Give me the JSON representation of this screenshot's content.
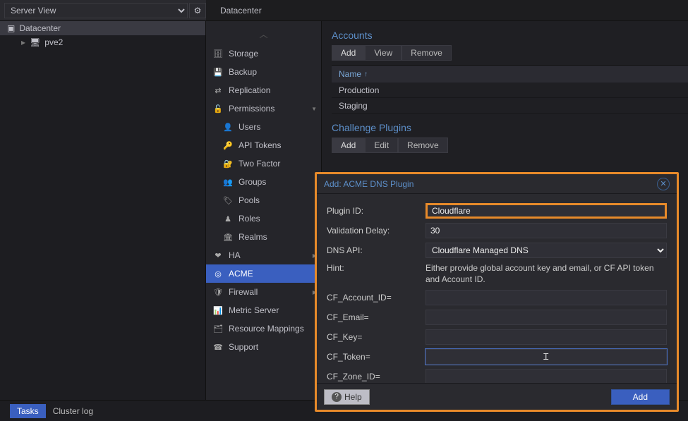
{
  "header": {
    "view_selector": "Server View",
    "breadcrumb": "Datacenter"
  },
  "tree": {
    "datacenter": "Datacenter",
    "node": "pve2"
  },
  "submenu": {
    "items": [
      {
        "icon": "storage",
        "label": "Storage"
      },
      {
        "icon": "backup",
        "label": "Backup"
      },
      {
        "icon": "replication",
        "label": "Replication"
      },
      {
        "icon": "permissions",
        "label": "Permissions",
        "chevron": "down"
      },
      {
        "icon": "users",
        "label": "Users",
        "indent": true
      },
      {
        "icon": "tokens",
        "label": "API Tokens",
        "indent": true
      },
      {
        "icon": "twofactor",
        "label": "Two Factor",
        "indent": true
      },
      {
        "icon": "groups",
        "label": "Groups",
        "indent": true
      },
      {
        "icon": "pools",
        "label": "Pools",
        "indent": true
      },
      {
        "icon": "roles",
        "label": "Roles",
        "indent": true
      },
      {
        "icon": "realms",
        "label": "Realms",
        "indent": true
      },
      {
        "icon": "ha",
        "label": "HA",
        "chevron": "right"
      },
      {
        "icon": "acme",
        "label": "ACME",
        "active": true
      },
      {
        "icon": "firewall",
        "label": "Firewall",
        "chevron": "right"
      },
      {
        "icon": "metric",
        "label": "Metric Server"
      },
      {
        "icon": "mappings",
        "label": "Resource Mappings"
      },
      {
        "icon": "support",
        "label": "Support"
      }
    ]
  },
  "main": {
    "accounts_title": "Accounts",
    "accounts_tb": {
      "add": "Add",
      "view": "View",
      "remove": "Remove"
    },
    "accounts_col": "Name",
    "accounts_rows": [
      "Production",
      "Staging"
    ],
    "plugins_title": "Challenge Plugins",
    "plugins_tb": {
      "add": "Add",
      "edit": "Edit",
      "remove": "Remove"
    }
  },
  "logs": {
    "tasks": "Tasks",
    "cluster": "Cluster log"
  },
  "dialog": {
    "title": "Add: ACME DNS Plugin",
    "labels": {
      "plugin_id": "Plugin ID:",
      "validation_delay": "Validation Delay:",
      "dns_api": "DNS API:",
      "hint": "Hint:",
      "cf_account": "CF_Account_ID=",
      "cf_email": "CF_Email=",
      "cf_key": "CF_Key=",
      "cf_token": "CF_Token=",
      "cf_zone": "CF_Zone_ID="
    },
    "values": {
      "plugin_id": "Cloudflare",
      "validation_delay": "30",
      "dns_api": "Cloudflare Managed DNS",
      "hint": "Either provide global account key and email, or CF API token and Account ID."
    },
    "help": "Help",
    "add": "Add"
  }
}
